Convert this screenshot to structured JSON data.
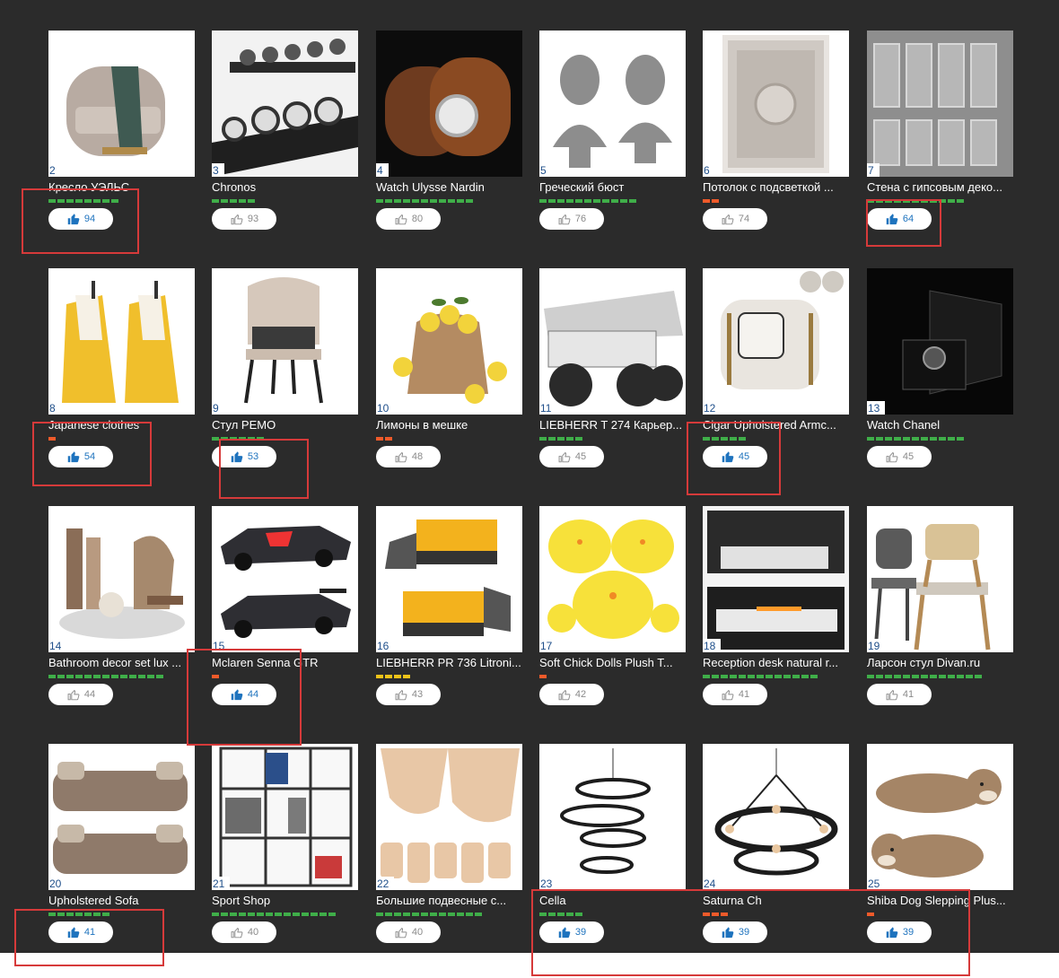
{
  "colors": {
    "background": "#2b2b2b",
    "rating_green": "#3fae49",
    "rating_orange": "#ef5a2a",
    "rating_yellow": "#f0c419",
    "like_active": "#1e73be",
    "like_inactive": "#8a8a8a",
    "highlight": "#d63a3a"
  },
  "cards": [
    {
      "num": "2",
      "title": "Кресло УЭЛЬС",
      "likes": "94",
      "liked": true,
      "rating_color": "green",
      "rating_segments": 8,
      "image": "armchair-with-throw"
    },
    {
      "num": "3",
      "title": "Chronos",
      "likes": "93",
      "liked": false,
      "rating_color": "green",
      "rating_segments": 5,
      "image": "watch-display"
    },
    {
      "num": "4",
      "title": "Watch Ulysse Nardin",
      "likes": "80",
      "liked": false,
      "rating_color": "green",
      "rating_segments": 11,
      "image": "watch-leather-case"
    },
    {
      "num": "5",
      "title": "Греческий бюст",
      "likes": "76",
      "liked": false,
      "rating_color": "green",
      "rating_segments": 11,
      "image": "greek-busts"
    },
    {
      "num": "6",
      "title": "Потолок с подсветкой ...",
      "likes": "74",
      "liked": false,
      "rating_color": "orange",
      "rating_segments": 2,
      "image": "ceiling-panel"
    },
    {
      "num": "7",
      "title": "Стена с гипсовым деко...",
      "likes": "64",
      "liked": true,
      "rating_color": "green",
      "rating_segments": 11,
      "image": "plaster-wall"
    },
    {
      "num": "8",
      "title": "Japanese clothes",
      "likes": "54",
      "liked": true,
      "rating_color": "orange",
      "rating_segments": 1,
      "image": "kimonos"
    },
    {
      "num": "9",
      "title": "Стул РЕМО",
      "likes": "53",
      "liked": true,
      "rating_color": "green",
      "rating_segments": 6,
      "image": "dining-chair"
    },
    {
      "num": "10",
      "title": "Лимоны в мешке",
      "likes": "48",
      "liked": false,
      "rating_color": "orange",
      "rating_segments": 2,
      "image": "lemons-sack"
    },
    {
      "num": "11",
      "title": "LIEBHERR T 274 Карьер...",
      "likes": "45",
      "liked": false,
      "rating_color": "green",
      "rating_segments": 5,
      "image": "mining-truck"
    },
    {
      "num": "12",
      "title": "Cigar Upholstered Armc...",
      "likes": "45",
      "liked": true,
      "rating_color": "green",
      "rating_segments": 5,
      "image": "white-armchair"
    },
    {
      "num": "13",
      "title": "Watch Chanel",
      "likes": "45",
      "liked": false,
      "rating_color": "green",
      "rating_segments": 11,
      "image": "watch-box"
    },
    {
      "num": "14",
      "title": "Bathroom decor set lux ...",
      "likes": "44",
      "liked": false,
      "rating_color": "green",
      "rating_segments": 13,
      "image": "bathroom-decor"
    },
    {
      "num": "15",
      "title": "Mclaren Senna GTR",
      "likes": "44",
      "liked": true,
      "rating_color": "orange",
      "rating_segments": 1,
      "image": "race-cars"
    },
    {
      "num": "16",
      "title": "LIEBHERR PR 736 Litroni...",
      "likes": "43",
      "liked": false,
      "rating_color": "yellow",
      "rating_segments": 4,
      "image": "bulldozers"
    },
    {
      "num": "17",
      "title": "Soft Chick Dolls Plush T...",
      "likes": "42",
      "liked": false,
      "rating_color": "orange",
      "rating_segments": 1,
      "image": "chick-plush"
    },
    {
      "num": "18",
      "title": "Reception desk natural r...",
      "likes": "41",
      "liked": false,
      "rating_color": "green",
      "rating_segments": 13,
      "image": "reception-desk"
    },
    {
      "num": "19",
      "title": "Ларсон стул Divan.ru",
      "likes": "41",
      "liked": false,
      "rating_color": "green",
      "rating_segments": 13,
      "image": "wooden-chairs"
    },
    {
      "num": "20",
      "title": "Upholstered Sofa",
      "likes": "41",
      "liked": true,
      "rating_color": "green",
      "rating_segments": 7,
      "image": "sofas"
    },
    {
      "num": "21",
      "title": "Sport Shop",
      "likes": "40",
      "liked": false,
      "rating_color": "green",
      "rating_segments": 14,
      "image": "shop-shelving"
    },
    {
      "num": "22",
      "title": "Большие подвесные с...",
      "likes": "40",
      "liked": false,
      "rating_color": "green",
      "rating_segments": 12,
      "image": "pendant-lamps"
    },
    {
      "num": "23",
      "title": "Cella",
      "likes": "39",
      "liked": true,
      "rating_color": "green",
      "rating_segments": 5,
      "image": "ring-chandelier"
    },
    {
      "num": "24",
      "title": "Saturna Ch",
      "likes": "39",
      "liked": true,
      "rating_color": "orange",
      "rating_segments": 3,
      "image": "round-chandelier"
    },
    {
      "num": "25",
      "title": "Shiba Dog Slepping Plus...",
      "likes": "39",
      "liked": true,
      "rating_color": "orange",
      "rating_segments": 1,
      "image": "dog-plush"
    }
  ]
}
